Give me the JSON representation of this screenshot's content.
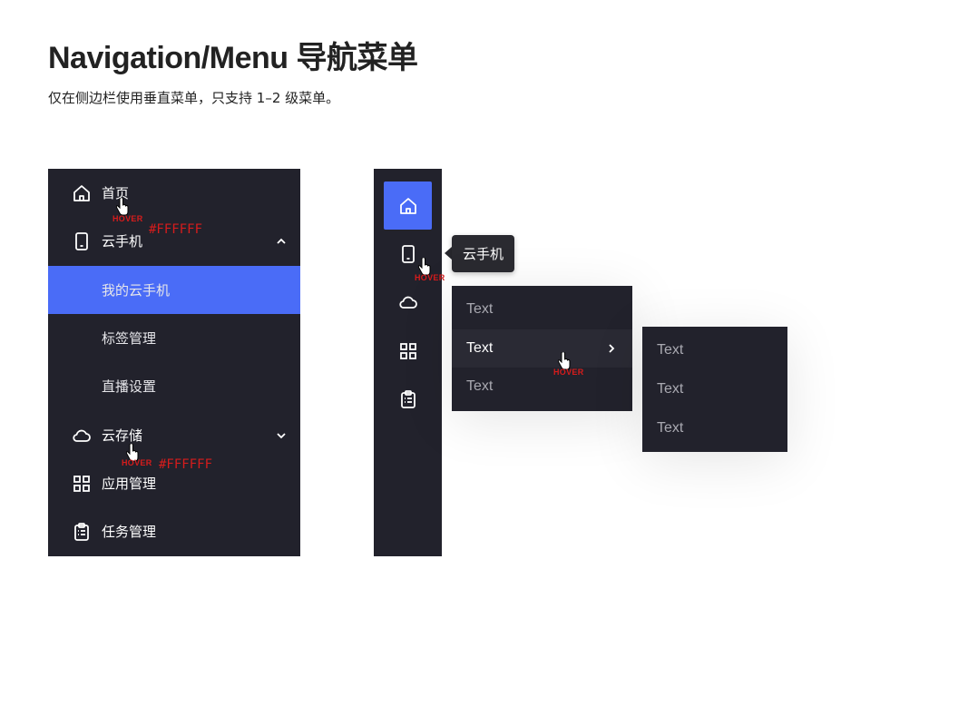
{
  "page": {
    "title": "Navigation/Menu 导航菜单",
    "subtitle": "仅在侧边栏使用垂直菜单，只支持 1–2 级菜单。"
  },
  "colors": {
    "sidebar_bg": "#22222C",
    "selected_bg": "#4A6CF7",
    "annotation_red": "#D61C1C",
    "text_white": "#FFFFFF"
  },
  "sidebar": {
    "items": [
      {
        "label": "首页",
        "icon": "home-icon"
      },
      {
        "label": "云手机",
        "icon": "phone-icon",
        "arrow": "chevron-up-icon"
      },
      {
        "label": "我的云手机",
        "selected": true
      },
      {
        "label": "标签管理"
      },
      {
        "label": "直播设置"
      },
      {
        "label": "云存储",
        "icon": "cloud-icon",
        "arrow": "chevron-down-icon"
      },
      {
        "label": "应用管理",
        "icon": "grid-icon"
      },
      {
        "label": "任务管理",
        "icon": "clipboard-icon"
      }
    ]
  },
  "annotations": {
    "hover": "HOVER",
    "hover_color": "#FFFFFF"
  },
  "rail": {
    "icons": [
      "home-icon",
      "phone-icon",
      "cloud-icon",
      "grid-icon",
      "clipboard-icon"
    ],
    "tooltip": "云手机"
  },
  "popup": {
    "items": [
      "Text",
      "Text",
      "Text"
    ]
  },
  "submenu": {
    "items": [
      "Text",
      "Text",
      "Text"
    ]
  }
}
